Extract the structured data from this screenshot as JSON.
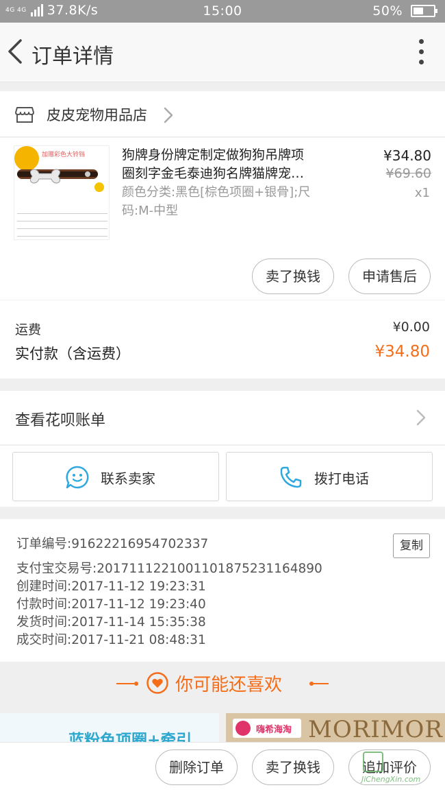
{
  "status_bar": {
    "network": "4G 4G",
    "speed": "37.8K/s",
    "time": "15:00",
    "battery_text": "50%",
    "battery_level": 0.5
  },
  "header": {
    "title": "订单详情",
    "back_icon": "chevron-left-icon",
    "more_icon": "more-vertical-icon"
  },
  "shop": {
    "icon": "store-icon",
    "name": "皮皮宠物用品店"
  },
  "product": {
    "image_banner": "加赠彩色大铃铛",
    "title_line1": "狗牌身份牌定制定做狗狗吊牌项",
    "title_line2": "圈刻字金毛泰迪狗名牌猫牌宠…",
    "spec_line1": "颜色分类:黑色[棕色项圈+银骨];尺",
    "spec_line2": "码:M-中型",
    "price": "¥34.80",
    "original_price": "¥69.60",
    "quantity": "x1",
    "sell_button": "卖了换钱",
    "after_sale_button": "申请售后"
  },
  "fees": {
    "shipping_label": "运费",
    "shipping_value": "¥0.00",
    "paid_label": "实付款（含运费）",
    "paid_value": "¥34.80"
  },
  "huabei": {
    "label": "查看花呗账单"
  },
  "contact": {
    "seller_label": "联系卖家",
    "phone_label": "拨打电话"
  },
  "order_info": {
    "order_no": "订单编号:916222169547023​37",
    "alipay_no": "支付宝交易号:2017111221001101875231164890",
    "created": "创建时间:2017-11-12 19:23:31",
    "paid": "付款时间:2017-11-12 19:23:40",
    "shipped": "发货时间:2017-11-14 15:35:38",
    "completed": "成交时间:2017-11-21 08:48:31",
    "copy_button": "复制"
  },
  "recommend": {
    "heading": "你可能还喜欢",
    "card1_text": "蓝粉色项圈+牵引",
    "card2_badge": "嗨希海淘",
    "card2_brand": "MORIMOR"
  },
  "bottom_bar": {
    "delete_button": "删除订单",
    "sell_button": "卖了换钱",
    "review_button": "追加评价"
  },
  "watermark": {
    "url": "JiChengXin.com"
  },
  "colors": {
    "accent": "#f56d18",
    "status_bar": "#9a9a9a",
    "icon_blue": "#2fa8e0"
  }
}
